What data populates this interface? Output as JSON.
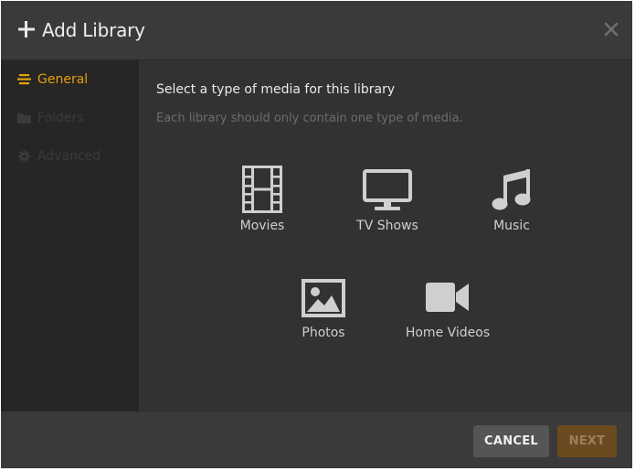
{
  "dialog": {
    "title": "Add Library",
    "add_icon": "plus-icon",
    "close_icon": "close-icon"
  },
  "sidebar": {
    "items": [
      {
        "label": "General",
        "icon": "list-icon",
        "state": "active"
      },
      {
        "label": "Folders",
        "icon": "folder-icon",
        "state": "disabled"
      },
      {
        "label": "Advanced",
        "icon": "gear-icon",
        "state": "disabled"
      }
    ]
  },
  "main": {
    "heading": "Select a type of media for this library",
    "subtext": "Each library should only contain one type of media.",
    "media_types": [
      {
        "label": "Movies",
        "icon": "film-icon"
      },
      {
        "label": "TV Shows",
        "icon": "tv-icon"
      },
      {
        "label": "Music",
        "icon": "music-note-icon"
      },
      {
        "label": "Photos",
        "icon": "photo-icon"
      },
      {
        "label": "Home Videos",
        "icon": "video-camera-icon"
      }
    ]
  },
  "footer": {
    "cancel_label": "CANCEL",
    "next_label": "NEXT"
  },
  "colors": {
    "accent": "#e5a00d",
    "header_bg": "#3a3a3a",
    "sidebar_bg": "#262626",
    "content_bg": "#323232",
    "next_button_bg": "#6b4a1f"
  }
}
